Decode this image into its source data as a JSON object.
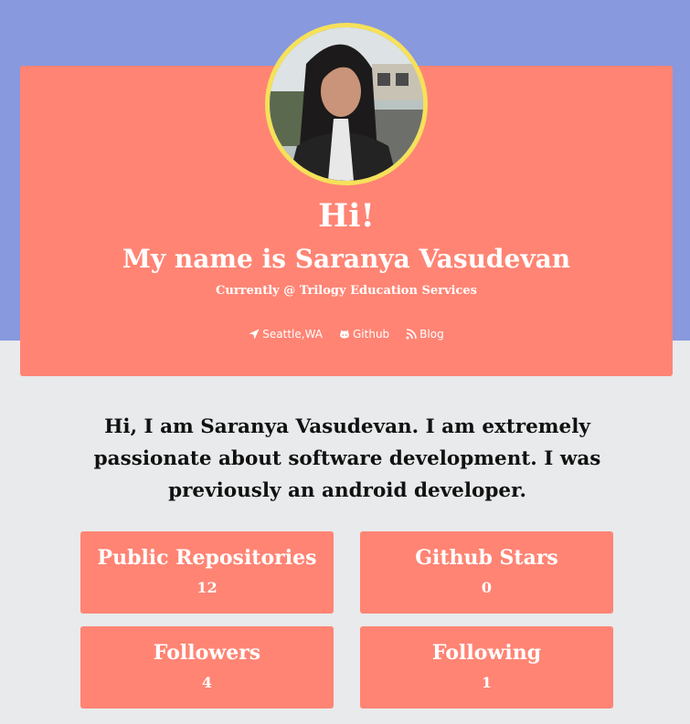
{
  "profile": {
    "greeting": "Hi!",
    "name_line": "My name is Saranya Vasudevan",
    "company_line": "Currently @ Trilogy Education Services",
    "avatar_icon": "profile-photo"
  },
  "links": [
    {
      "label": "Seattle,WA",
      "icon": "location-arrow-icon"
    },
    {
      "label": "Github",
      "icon": "github-icon"
    },
    {
      "label": "Blog",
      "icon": "rss-icon"
    }
  ],
  "bio": "Hi, I am Saranya Vasudevan. I am extremely passionate about software development. I was previously an android developer.",
  "stats": [
    {
      "title": "Public Repositories",
      "value": "12"
    },
    {
      "title": "Github Stars",
      "value": "0"
    },
    {
      "title": "Followers",
      "value": "4"
    },
    {
      "title": "Following",
      "value": "1"
    }
  ],
  "colors": {
    "header_band": "#8899de",
    "card": "#ff8474",
    "avatar_border": "#f6e15a",
    "page_background": "#e8eaeb"
  }
}
